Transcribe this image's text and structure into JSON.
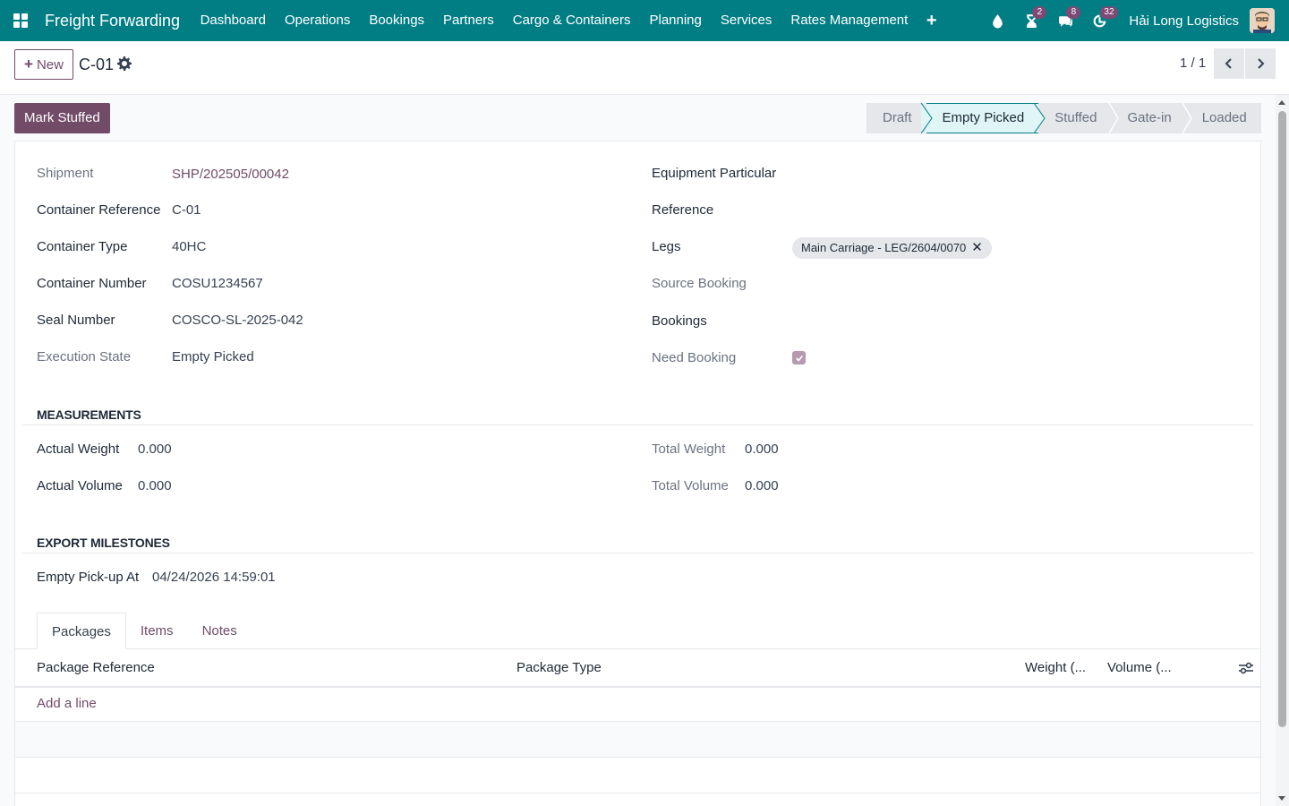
{
  "navbar": {
    "brand": "Freight Forwarding",
    "menu": [
      "Dashboard",
      "Operations",
      "Bookings",
      "Partners",
      "Cargo & Containers",
      "Planning",
      "Services",
      "Rates Management"
    ],
    "badges": {
      "activity": "2",
      "messages": "8",
      "clock": "32"
    },
    "company": "Hải Long Logistics"
  },
  "control": {
    "new_label": "New",
    "record_title": "C-01",
    "pager": "1 / 1"
  },
  "statusbar": {
    "action_label": "Mark Stuffed",
    "stages": [
      "Draft",
      "Empty Picked",
      "Stuffed",
      "Gate-in",
      "Loaded"
    ],
    "active_stage": "Empty Picked"
  },
  "form": {
    "left": {
      "shipment_label": "Shipment",
      "shipment_value": "SHP/202505/00042",
      "container_ref_label": "Container Reference",
      "container_ref_value": "C-01",
      "container_type_label": "Container Type",
      "container_type_value": "40HC",
      "container_number_label": "Container Number",
      "container_number_value": "COSU1234567",
      "seal_number_label": "Seal Number",
      "seal_number_value": "COSCO-SL-2025-042",
      "execution_state_label": "Execution State",
      "execution_state_value": "Empty Picked"
    },
    "right": {
      "equipment_label": "Equipment Particular",
      "reference_label": "Reference",
      "legs_label": "Legs",
      "legs_tag": "Main Carriage - LEG/2604/0070",
      "source_booking_label": "Source Booking",
      "bookings_label": "Bookings",
      "need_booking_label": "Need Booking",
      "need_booking_checked": true
    },
    "measurements": {
      "title": "MEASUREMENTS",
      "actual_weight_label": "Actual Weight",
      "actual_weight_value": "0.000",
      "actual_volume_label": "Actual Volume",
      "actual_volume_value": "0.000",
      "total_weight_label": "Total Weight",
      "total_weight_value": "0.000",
      "total_volume_label": "Total Volume",
      "total_volume_value": "0.000"
    },
    "milestones": {
      "title": "EXPORT MILESTONES",
      "empty_pickup_label": "Empty Pick-up At",
      "empty_pickup_value": "04/24/2026 14:59:01"
    }
  },
  "tabs": [
    "Packages",
    "Items",
    "Notes"
  ],
  "packages_table": {
    "columns": [
      "Package Reference",
      "Package Type",
      "Weight (...",
      "Volume (..."
    ],
    "add_line": "Add a line"
  },
  "colors": {
    "navbar": "#017e84",
    "primary": "#714b67"
  }
}
